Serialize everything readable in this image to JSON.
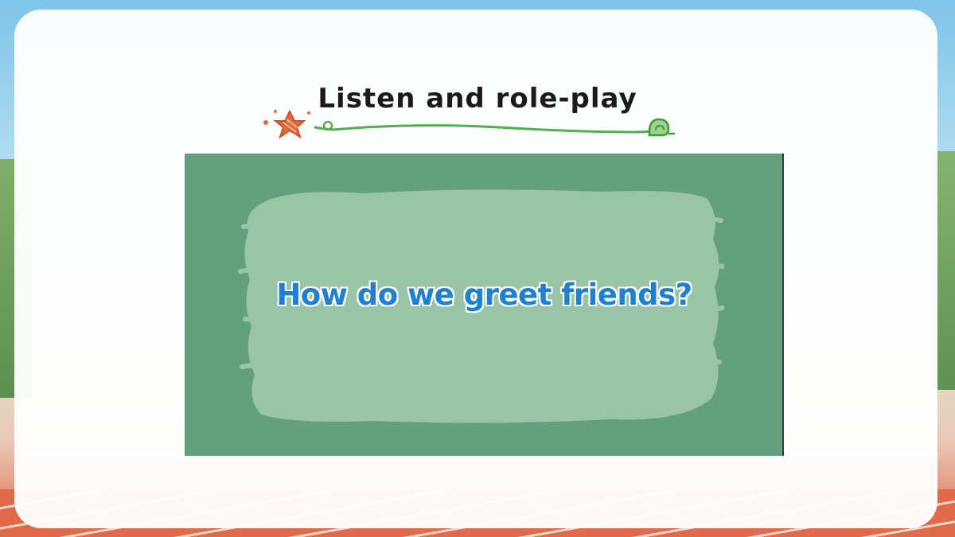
{
  "slide": {
    "title": "Listen and role-play",
    "video": {
      "question": "How do we greet friends?"
    }
  },
  "colors": {
    "card": "#ffffff",
    "video_background": "#64a07e",
    "brush_patch": "#99c4a8",
    "question_text": "#1f7fd0",
    "title_text": "#1a1a1a",
    "star_decoration": "#e36b3a",
    "vine_decoration": "#52b04a"
  },
  "icons": {
    "title_left": "star-doodle-icon",
    "title_right": "snail-doodle-icon"
  }
}
